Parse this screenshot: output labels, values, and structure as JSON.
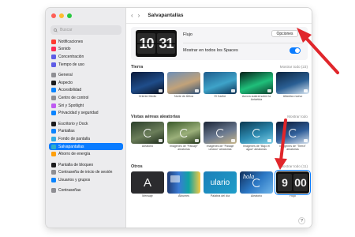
{
  "window": {
    "title": "Salvapantallas"
  },
  "sidebar": {
    "search_placeholder": "Buscar",
    "items": [
      {
        "label": "Notificaciones",
        "icon": "bell-icon",
        "color": "#ff3b30"
      },
      {
        "label": "Sonido",
        "icon": "speaker-icon",
        "color": "#ff2d55"
      },
      {
        "label": "Concentración",
        "icon": "moon-icon",
        "color": "#5e5ce6"
      },
      {
        "label": "Tiempo de uso",
        "icon": "hourglass-icon",
        "color": "#5e5ce6"
      },
      {
        "label": "General",
        "icon": "gear-icon",
        "color": "#8e8e93"
      },
      {
        "label": "Aspecto",
        "icon": "appearance-icon",
        "color": "#1c1c1e"
      },
      {
        "label": "Accesibilidad",
        "icon": "accessibility-icon",
        "color": "#0a84ff"
      },
      {
        "label": "Centro de control",
        "icon": "control-center-icon",
        "color": "#8e8e93"
      },
      {
        "label": "Siri y Spotlight",
        "icon": "siri-icon",
        "color": "#bf5af2"
      },
      {
        "label": "Privacidad y seguridad",
        "icon": "hand-icon",
        "color": "#0a84ff"
      },
      {
        "label": "Escritorio y Dock",
        "icon": "dock-icon",
        "color": "#1c1c1e"
      },
      {
        "label": "Pantallas",
        "icon": "display-icon",
        "color": "#0a84ff"
      },
      {
        "label": "Fondo de pantalla",
        "icon": "wallpaper-icon",
        "color": "#32ade6"
      },
      {
        "label": "Salvapantallas",
        "icon": "screensaver-icon",
        "color": "#30b0c7"
      },
      {
        "label": "Ahorro de energía",
        "icon": "battery-icon",
        "color": "#ff9f0a"
      },
      {
        "label": "Pantalla de bloqueo",
        "icon": "lock-icon",
        "color": "#1c1c1e"
      },
      {
        "label": "Contraseña de inicio de sesión",
        "icon": "key-icon",
        "color": "#8e8e93"
      },
      {
        "label": "Usuarios y grupos",
        "icon": "users-icon",
        "color": "#0a84ff"
      },
      {
        "label": "Contraseñas",
        "icon": "key-icon",
        "color": "#8e8e93"
      }
    ],
    "active_label": "Salvapantallas"
  },
  "main": {
    "preview": {
      "clock_hours": "10",
      "clock_minutes": "31",
      "name": "Flujo",
      "options_label": "Opciones",
      "spaces_label": "Mostrar en todos los Spaces",
      "spaces_enabled": true
    },
    "sections": [
      {
        "title": "Tierra",
        "link": "Mostrar todo (23)",
        "items": [
          {
            "caption": "Oriente Medio",
            "colors": [
              "#0b1a3a",
              "#1f4d8a",
              "#0a0f1d"
            ]
          },
          {
            "caption": "Norte de África",
            "colors": [
              "#6d8fb8",
              "#c2a279",
              "#2c4f78"
            ]
          },
          {
            "caption": "El Caribe",
            "colors": [
              "#1e5c8c",
              "#3ea3c9",
              "#0c2f52"
            ]
          },
          {
            "caption": "Aurora austral sobre la Antártida",
            "colors": [
              "#052019",
              "#1fbf7a",
              "#0b3d2c"
            ]
          },
          {
            "caption": "Atlántico nuevo",
            "colors": [
              "#0c2540",
              "#2a5f94",
              "#d9e6f2"
            ]
          }
        ]
      },
      {
        "title": "Vistas aéreas aleatorias",
        "link": "Mostrar todo",
        "items": [
          {
            "caption": "Aleatorio",
            "colors": [
              "#2b3f2a",
              "#6b7e5a",
              "#1c2a1b"
            ]
          },
          {
            "caption": "Imágenes de \"Paisaje\" aleatorias",
            "colors": [
              "#3a5a2a",
              "#9bb07a",
              "#203318"
            ]
          },
          {
            "caption": "Imágenes de \"Paisaje urbano\" aleatorias",
            "colors": [
              "#1b2536",
              "#6b7a91",
              "#c9b78a"
            ]
          },
          {
            "caption": "Imágenes de \"Bajo el agua\" aleatorias",
            "colors": [
              "#0b3a52",
              "#2d8ab0",
              "#7fd0e6"
            ]
          },
          {
            "caption": "Imágenes de \"Tierra\" aleatorias",
            "colors": [
              "#0c1830",
              "#2f5e9a",
              "#d7e2ee"
            ]
          }
        ]
      },
      {
        "title": "Otros",
        "link": "Mostrar todo (11)",
        "items": [
          {
            "caption": "Mensaje",
            "kind": "message",
            "text": "A"
          },
          {
            "caption": "Álbumes",
            "kind": "albums"
          },
          {
            "caption": "Palabra del día",
            "kind": "word",
            "text": "ulario"
          },
          {
            "caption": "Aleatorio",
            "kind": "random",
            "text": "hola"
          },
          {
            "caption": "Flujo",
            "kind": "flip",
            "text_hours": "9",
            "text_minutes": "00"
          }
        ]
      }
    ],
    "help_label": "?"
  },
  "colors": {
    "accent": "#0a7cff",
    "annotation": "#e0262b"
  }
}
